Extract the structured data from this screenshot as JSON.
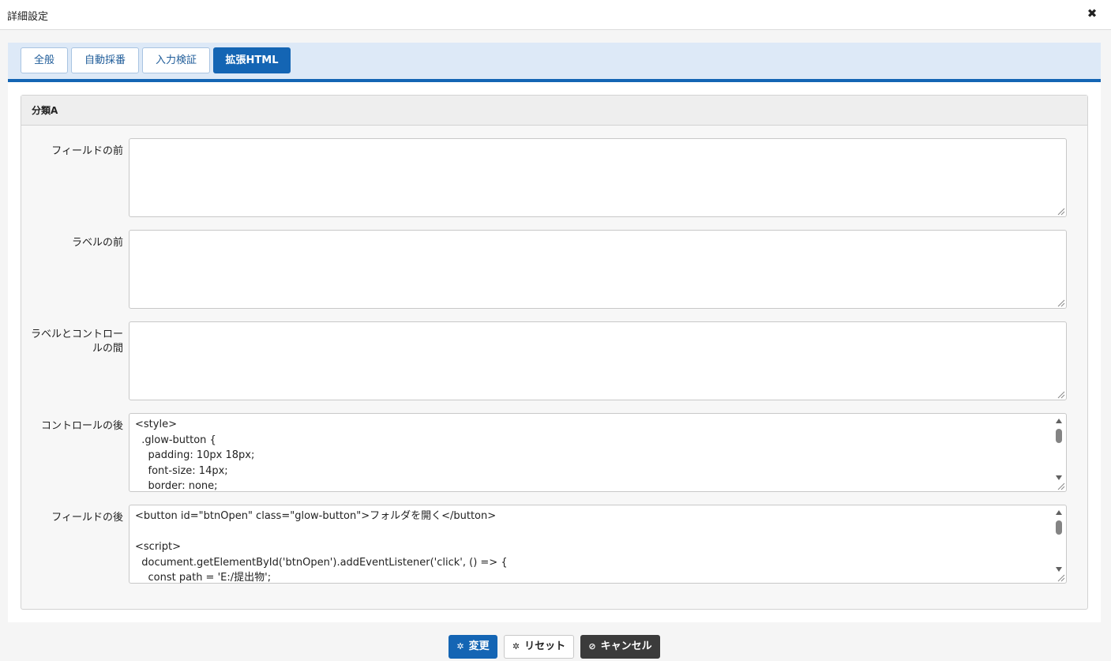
{
  "dialog": {
    "title": "詳細設定",
    "close_icon": "close-icon"
  },
  "tabs": [
    {
      "label": "全般",
      "active": false
    },
    {
      "label": "自動採番",
      "active": false
    },
    {
      "label": "入力検証",
      "active": false
    },
    {
      "label": "拡張HTML",
      "active": true
    }
  ],
  "panel": {
    "title": "分類A",
    "fields": [
      {
        "label": "フィールドの前",
        "value": ""
      },
      {
        "label": "ラベルの前",
        "value": ""
      },
      {
        "label": "ラベルとコントロールの間",
        "value": ""
      },
      {
        "label": "コントロールの後",
        "value": "<style>\n  .glow-button {\n    padding: 10px 18px;\n    font-size: 14px;\n    border: none;"
      },
      {
        "label": "フィールドの後",
        "value": "<button id=\"btnOpen\" class=\"glow-button\">フォルダを開く</button>\n\n<script>\n  document.getElementById('btnOpen').addEventListener('click', () => {\n    const path = 'E:/提出物';"
      }
    ]
  },
  "footer": {
    "change_label": "変更",
    "reset_label": "リセット",
    "cancel_label": "キャンセル"
  },
  "colors": {
    "accent": "#1465b4",
    "tab_bar_bg": "#dde9f7",
    "cancel_bg": "#3b3b3b"
  }
}
